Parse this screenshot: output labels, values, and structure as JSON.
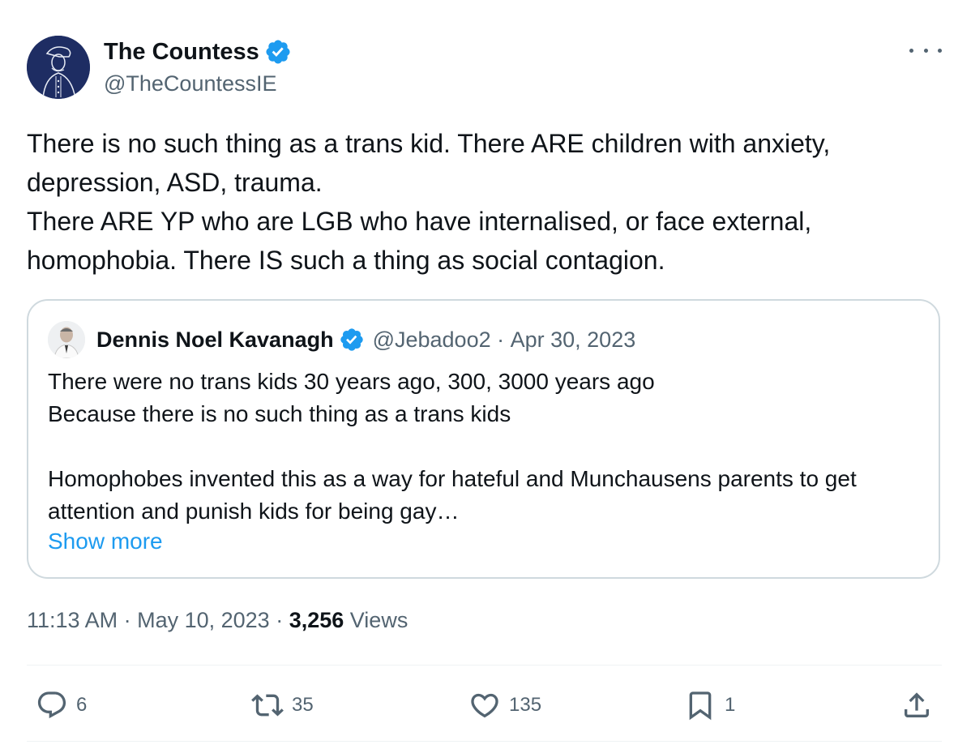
{
  "tweet": {
    "author_name": "The Countess",
    "author_handle": "@TheCountessIE",
    "text": "There is no such thing as a trans kid. There ARE children with anxiety, depression, ASD, trauma.\nThere ARE YP who are LGB who have internalised, or face external, homophobia. There IS such a thing as social contagion.",
    "time": "11:13 AM",
    "date": "May 10, 2023",
    "views_count": "3,256",
    "views_label": "Views"
  },
  "quote": {
    "author_name": "Dennis Noel Kavanagh",
    "author_handle": "@Jebadoo2",
    "date": "Apr 30, 2023",
    "text": "There were no trans kids 30 years ago, 300, 3000 years ago\nBecause there is no such thing as a trans kids\n\nHomophobes invented this as a way for hateful and Munchausens parents to get attention and punish kids for being gay…",
    "show_more": "Show more"
  },
  "actions": {
    "replies": "6",
    "reposts": "35",
    "likes": "135",
    "bookmarks": "1"
  },
  "icons": [
    "verified-badge-icon",
    "more-icon",
    "reply-icon",
    "repost-icon",
    "like-icon",
    "bookmark-icon",
    "share-icon"
  ],
  "colors": {
    "verified": "#1d9bf0",
    "link": "#1d9bf0",
    "secondary_text": "#536471",
    "avatar_bg": "#1e2d63"
  }
}
